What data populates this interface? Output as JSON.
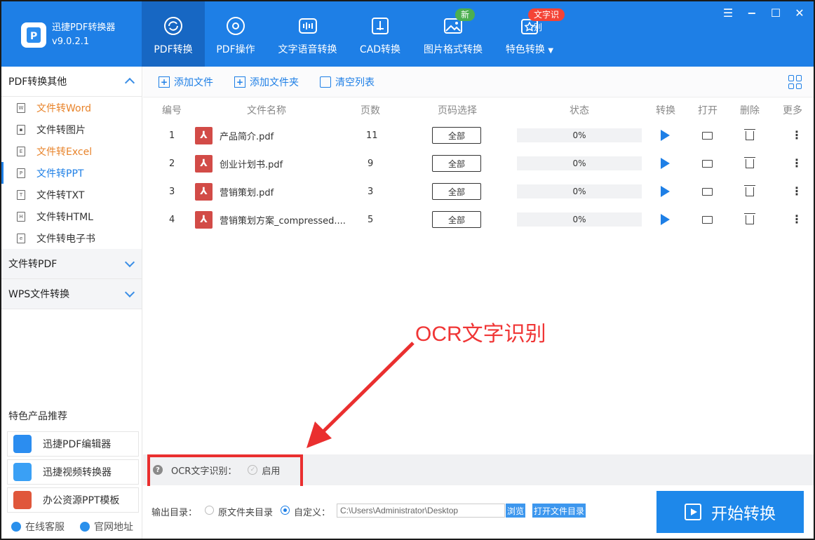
{
  "app": {
    "name": "迅捷PDF转换器",
    "version": "v9.0.2.1"
  },
  "nav": [
    {
      "label": "PDF转换",
      "icon": "refresh-doc-icon",
      "active": true
    },
    {
      "label": "PDF操作",
      "icon": "gear-doc-icon",
      "active": false
    },
    {
      "label": "文字语音转换",
      "icon": "audio-wave-icon",
      "active": false
    },
    {
      "label": "CAD转换",
      "icon": "cad-icon",
      "active": false
    },
    {
      "label": "图片格式转换",
      "icon": "image-icon",
      "active": false
    },
    {
      "label": "特色转换",
      "icon": "special-convert-icon",
      "active": false
    }
  ],
  "badges": {
    "new": "新",
    "ocr": "文字识别"
  },
  "sidebar": {
    "group1": {
      "title": "PDF转换其他",
      "items": [
        {
          "label": "文件转Word",
          "icon": "W"
        },
        {
          "label": "文件转图片",
          "icon": "▪"
        },
        {
          "label": "文件转Excel",
          "icon": "E"
        },
        {
          "label": "文件转PPT",
          "icon": "P"
        },
        {
          "label": "文件转TXT",
          "icon": "T"
        },
        {
          "label": "文件转HTML",
          "icon": "H"
        },
        {
          "label": "文件转电子书",
          "icon": "e"
        }
      ]
    },
    "group2": {
      "title": "文件转PDF"
    },
    "group3": {
      "title": "WPS文件转换"
    },
    "promo_title": "特色产品推荐",
    "promos": [
      {
        "label": "迅捷PDF编辑器"
      },
      {
        "label": "迅捷视频转换器"
      },
      {
        "label": "办公资源PPT模板"
      }
    ],
    "links": {
      "support": "在线客服",
      "site": "官网地址"
    }
  },
  "toolbar": {
    "add_file": "添加文件",
    "add_folder": "添加文件夹",
    "clear": "清空列表"
  },
  "table": {
    "headers": {
      "num": "编号",
      "name": "文件名称",
      "pages": "页数",
      "range": "页码选择",
      "status": "状态",
      "convert": "转换",
      "open": "打开",
      "delete": "删除",
      "more": "更多"
    },
    "rows": [
      {
        "num": "1",
        "name": "产品简介.pdf",
        "pages": "11",
        "range": "全部",
        "progress": "0%"
      },
      {
        "num": "2",
        "name": "创业计划书.pdf",
        "pages": "9",
        "range": "全部",
        "progress": "0%"
      },
      {
        "num": "3",
        "name": "营销策划.pdf",
        "pages": "3",
        "range": "全部",
        "progress": "0%"
      },
      {
        "num": "4",
        "name": "营销策划方案_compressed....",
        "pages": "5",
        "range": "全部",
        "progress": "0%"
      }
    ]
  },
  "annotation": "OCR文字识别",
  "ocr": {
    "label": "OCR文字识别：",
    "enable": "启用"
  },
  "output": {
    "label": "输出目录：",
    "source_dir": "原文件夹目录",
    "custom": "自定义：",
    "path": "C:\\Users\\Administrator\\Desktop",
    "browse": "浏览",
    "open_dir": "打开文件目录"
  },
  "start_button": "开始转换",
  "colors": {
    "primary": "#1e7fe6",
    "annotation_red": "#ea2f2f",
    "pdf_red": "#d24b47",
    "orange": "#e8832a"
  }
}
